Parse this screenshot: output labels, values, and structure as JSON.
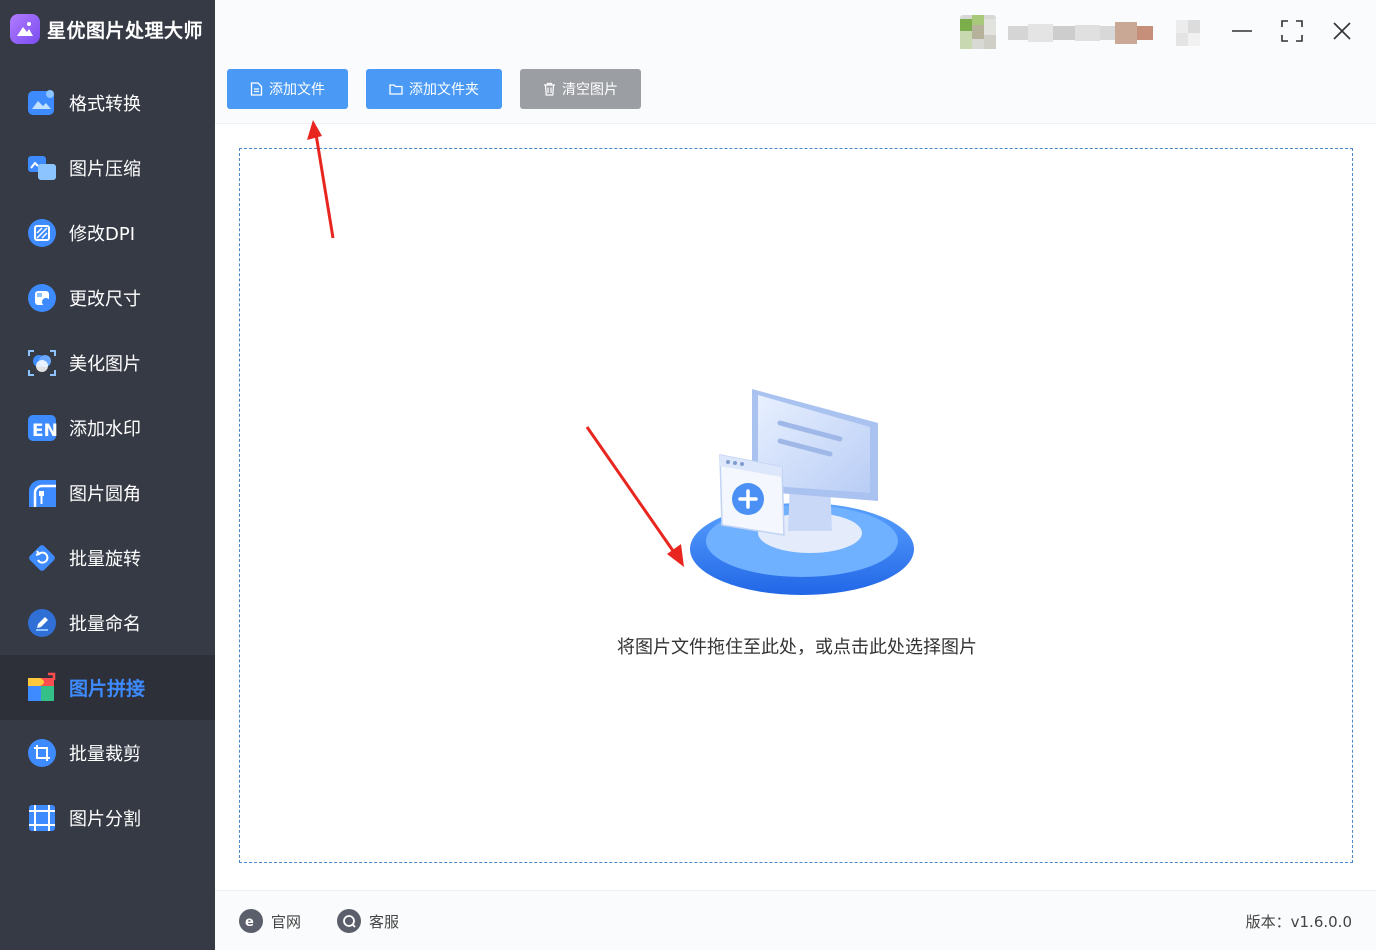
{
  "app": {
    "title": "星优图片处理大师",
    "brand_color": "#7a4cf0",
    "accent_color": "#3d8bff"
  },
  "sidebar": {
    "items": [
      {
        "label": "格式转换",
        "icon": "image-convert-icon",
        "active": false
      },
      {
        "label": "图片压缩",
        "icon": "image-compress-icon",
        "active": false
      },
      {
        "label": "修改DPI",
        "icon": "dpi-icon",
        "active": false
      },
      {
        "label": "更改尺寸",
        "icon": "resize-icon",
        "active": false
      },
      {
        "label": "美化图片",
        "icon": "beautify-icon",
        "active": false
      },
      {
        "label": "添加水印",
        "icon": "watermark-icon",
        "active": false
      },
      {
        "label": "图片圆角",
        "icon": "rounded-corner-icon",
        "active": false
      },
      {
        "label": "批量旋转",
        "icon": "rotate-icon",
        "active": false
      },
      {
        "label": "批量命名",
        "icon": "rename-icon",
        "active": false
      },
      {
        "label": "图片拼接",
        "icon": "puzzle-stitch-icon",
        "active": true
      },
      {
        "label": "批量裁剪",
        "icon": "crop-icon",
        "active": false
      },
      {
        "label": "图片分割",
        "icon": "split-icon",
        "active": false
      }
    ]
  },
  "toolbar": {
    "add_file": "添加文件",
    "add_folder": "添加文件夹",
    "clear_images": "清空图片"
  },
  "dropzone": {
    "hint": "将图片文件拖住至此处，或点击此处选择图片"
  },
  "footer": {
    "website": "官网",
    "support": "客服",
    "version": "版本：v1.6.0.0"
  }
}
